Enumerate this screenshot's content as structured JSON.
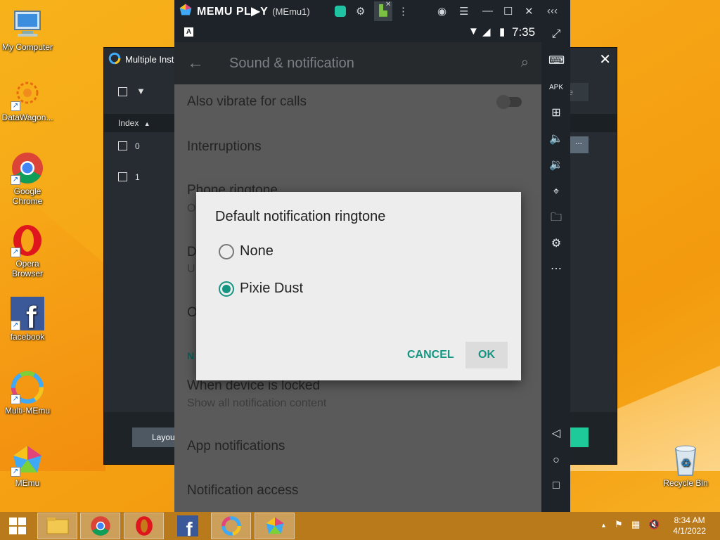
{
  "desktop": {
    "icons": [
      {
        "label": "My Computer"
      },
      {
        "label": "DataWagon..."
      },
      {
        "label": "Google Chrome"
      },
      {
        "label": "Opera Browser"
      },
      {
        "label": "facebook"
      },
      {
        "label": "Multi-MEmu"
      },
      {
        "label": "MEmu"
      },
      {
        "label": "Recycle Bin"
      }
    ]
  },
  "multi_instance": {
    "title": "Multiple Insta",
    "col_index": "Index",
    "rows": [
      "0",
      "1"
    ],
    "search_partial": "te",
    "dots": "...",
    "footer_button": "Layou"
  },
  "memu": {
    "logo": "MEMU PL▶Y",
    "instance": "(MEmu1)",
    "status": {
      "badge": "A",
      "time": "7:35"
    }
  },
  "settings": {
    "title": "Sound & notification",
    "items": [
      {
        "label": "Also vibrate for calls"
      },
      {
        "label": "Interruptions"
      },
      {
        "label": "Phone ringtone",
        "sub": "O"
      },
      {
        "label": "D",
        "sub": "U"
      },
      {
        "label": "O"
      }
    ],
    "section": "N",
    "locked_label": "When device is locked",
    "locked_sub": "Show all notification content",
    "app_notifications": "App notifications",
    "notification_access": "Notification access"
  },
  "dialog": {
    "title": "Default notification ringtone",
    "options": [
      {
        "label": "None",
        "selected": false
      },
      {
        "label": "Pixie Dust",
        "selected": true
      }
    ],
    "cancel": "CANCEL",
    "ok": "OK"
  },
  "taskbar": {
    "time": "8:34 AM",
    "date": "4/1/2022"
  },
  "colors": {
    "accent": "#159582",
    "wallpaper": "#f6a516",
    "taskbar": "#b97a1c"
  }
}
